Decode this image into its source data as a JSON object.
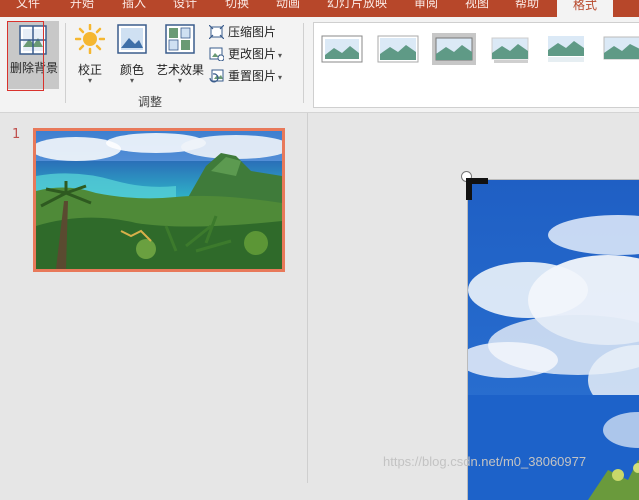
{
  "tabs": [
    {
      "label": "文件",
      "active": false
    },
    {
      "label": "开始",
      "active": false
    },
    {
      "label": "插入",
      "active": false
    },
    {
      "label": "设计",
      "active": false
    },
    {
      "label": "切换",
      "active": false
    },
    {
      "label": "动画",
      "active": false
    },
    {
      "label": "幻灯片放映",
      "active": false
    },
    {
      "label": "审阅",
      "active": false
    },
    {
      "label": "视图",
      "active": false
    },
    {
      "label": "帮助",
      "active": false
    },
    {
      "label": "格式",
      "active": true
    }
  ],
  "ribbon": {
    "remove_background": "删除背景",
    "corrections": "校正",
    "color": "颜色",
    "artistic_effects": "艺术效果",
    "compress_pictures": "压缩图片",
    "change_picture": "更改图片",
    "reset_picture": "重置图片",
    "adjust_group_label": "调整",
    "dropdown_glyph": "▾"
  },
  "slides": {
    "number": "1"
  },
  "watermark": "https://blog.csdn.net/m0_38060977",
  "colors": {
    "accent": "#b7472a",
    "selection": "#e8795a",
    "outline_red": "#d9322d"
  }
}
